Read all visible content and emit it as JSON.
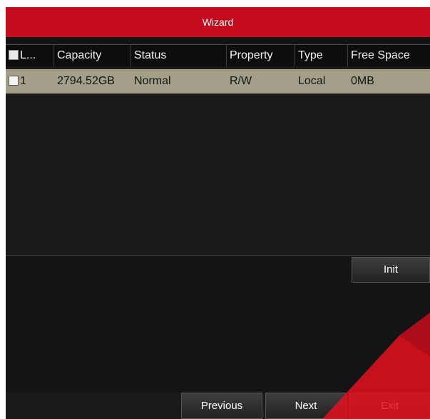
{
  "window": {
    "title": "Wizard"
  },
  "colors": {
    "title_bar": "#c40a1d",
    "selected_row": "#a39f88",
    "background": "#141414"
  },
  "table": {
    "columns": [
      "L...",
      "Capacity",
      "Status",
      "Property",
      "Type",
      "Free Space"
    ],
    "rows": [
      {
        "label": "1",
        "capacity": "2794.52GB",
        "status": "Normal",
        "property": "R/W",
        "type": "Local",
        "free_space": "0MB"
      }
    ]
  },
  "actions": {
    "init": "Init"
  },
  "footer": {
    "previous": "Previous",
    "next": "Next",
    "exit": "Exit"
  }
}
